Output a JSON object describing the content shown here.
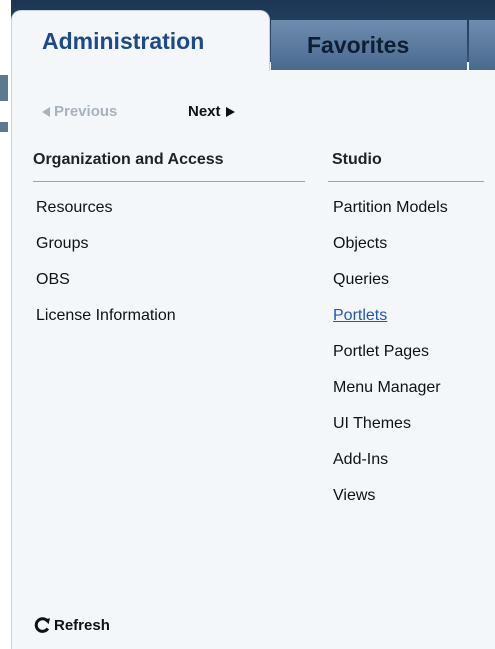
{
  "tabs": [
    {
      "label": "Administration",
      "active": true
    },
    {
      "label": "Favorites",
      "active": false
    }
  ],
  "pager": {
    "previous": "Previous",
    "next": "Next"
  },
  "columns": [
    {
      "heading": "Organization and Access",
      "items": [
        "Resources",
        "Groups",
        "OBS",
        "License Information"
      ]
    },
    {
      "heading": "Studio",
      "items": [
        "Partition Models",
        "Objects",
        "Queries",
        "Portlets",
        "Portlet Pages",
        "Menu Manager",
        "UI Themes",
        "Add-Ins",
        "Views"
      ],
      "highlighted": "Portlets"
    }
  ],
  "refresh": {
    "label": "Refresh",
    "icon": "refresh-icon"
  },
  "colors": {
    "active_tab_text": "#1e4a8a",
    "link": "#2255bb",
    "panel_bg": "#f4f7fa"
  }
}
